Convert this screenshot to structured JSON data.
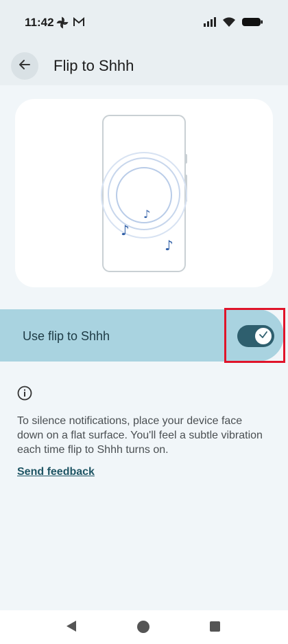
{
  "status_bar": {
    "time": "11:42",
    "left_icons": [
      "pinwheel-icon",
      "gmail-icon"
    ],
    "right_icons": [
      "signal-icon",
      "wifi-icon",
      "battery-icon"
    ]
  },
  "app_bar": {
    "title": "Flip to Shhh",
    "back_icon": "arrow-back-icon"
  },
  "setting": {
    "label": "Use flip to Shhh",
    "enabled": true,
    "accent_color": "#2e5f6e",
    "row_color": "#a9d3e0"
  },
  "info": {
    "icon": "info-icon",
    "description": "To silence notifications, place your device face down on a flat surface. You'll feel a subtle vibration each time flip to Shhh turns on.",
    "feedback_link": "Send feedback"
  },
  "nav": {
    "icons": [
      "nav-back-icon",
      "nav-home-icon",
      "nav-recents-icon"
    ]
  }
}
